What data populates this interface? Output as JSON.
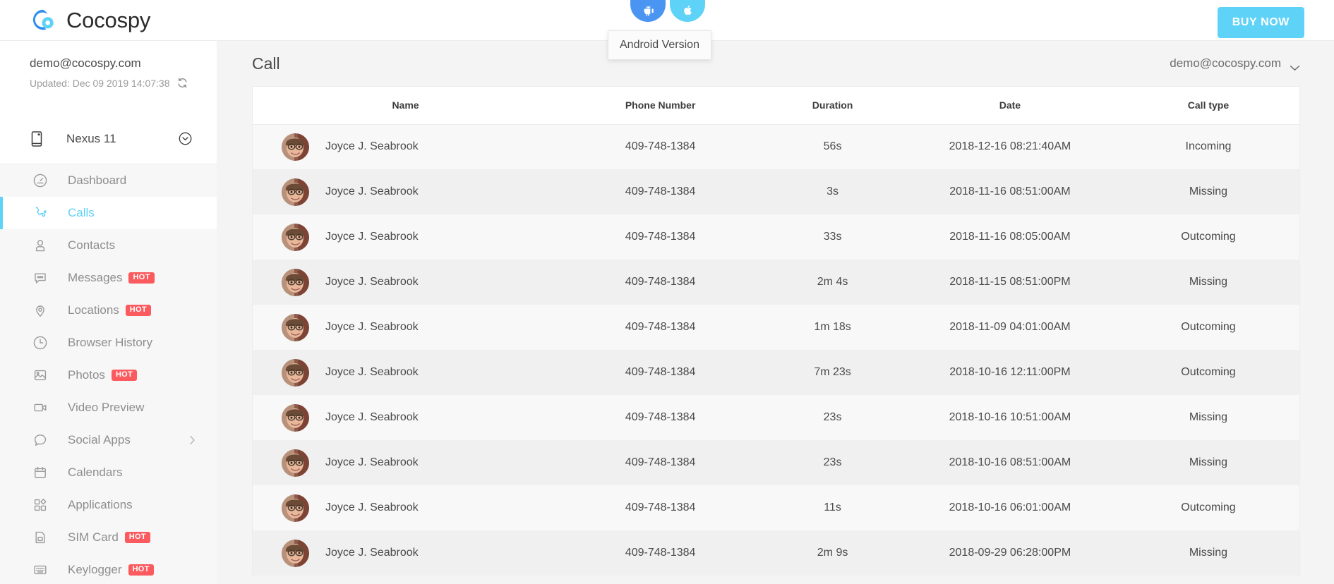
{
  "brand": {
    "name": "Cocospy",
    "logo_icon": "cocospy-logo-icon"
  },
  "topbar": {
    "platform_buttons": [
      {
        "name": "android",
        "icon": "android-icon",
        "color": "#4a95f2"
      },
      {
        "name": "ios",
        "icon": "apple-icon",
        "color": "#5ed2f7"
      }
    ],
    "tooltip": "Android Version",
    "buy_now_label": "BUY NOW",
    "buy_now_color": "#5ed2f7"
  },
  "sidebar": {
    "account_email": "demo@cocospy.com",
    "updated_text": "Updated: Dec 09 2019 14:07:38",
    "refresh_icon": "refresh-icon",
    "device": {
      "name": "Nexus 11",
      "icon": "phone-icon",
      "chevron": "chevron-down-circle-icon"
    },
    "items": [
      {
        "label": "Dashboard",
        "icon": "dashboard-icon",
        "active": false,
        "badge": "",
        "arrow": false
      },
      {
        "label": "Calls",
        "icon": "phone-call-icon",
        "active": true,
        "badge": "",
        "arrow": false
      },
      {
        "label": "Contacts",
        "icon": "contacts-icon",
        "active": false,
        "badge": "",
        "arrow": false
      },
      {
        "label": "Messages",
        "icon": "message-icon",
        "active": false,
        "badge": "HOT",
        "arrow": false
      },
      {
        "label": "Locations",
        "icon": "location-pin-icon",
        "active": false,
        "badge": "HOT",
        "arrow": false
      },
      {
        "label": "Browser History",
        "icon": "clock-icon",
        "active": false,
        "badge": "",
        "arrow": false
      },
      {
        "label": "Photos",
        "icon": "photo-icon",
        "active": false,
        "badge": "HOT",
        "arrow": false
      },
      {
        "label": "Video Preview",
        "icon": "video-camera-icon",
        "active": false,
        "badge": "",
        "arrow": false
      },
      {
        "label": "Social Apps",
        "icon": "chat-bubble-icon",
        "active": false,
        "badge": "",
        "arrow": true
      },
      {
        "label": "Calendars",
        "icon": "calendar-icon",
        "active": false,
        "badge": "",
        "arrow": false
      },
      {
        "label": "Applications",
        "icon": "applications-icon",
        "active": false,
        "badge": "",
        "arrow": false
      },
      {
        "label": "SIM Card",
        "icon": "sim-card-icon",
        "active": false,
        "badge": "HOT",
        "arrow": false
      },
      {
        "label": "Keylogger",
        "icon": "keyboard-icon",
        "active": false,
        "badge": "HOT",
        "arrow": false
      }
    ],
    "accent_color": "#5ed2f7",
    "badge_color": "#fb5a5f"
  },
  "main": {
    "page_title": "Call",
    "account_dropdown": "demo@cocospy.com",
    "table": {
      "columns": [
        "Name",
        "Phone Number",
        "Duration",
        "Date",
        "Call type"
      ],
      "rows": [
        {
          "name": "Joyce J. Seabrook",
          "phone": "409-748-1384",
          "duration": "56s",
          "date": "2018-12-16 08:21:40AM",
          "type": "Incoming"
        },
        {
          "name": "Joyce J. Seabrook",
          "phone": "409-748-1384",
          "duration": "3s",
          "date": "2018-11-16 08:51:00AM",
          "type": "Missing"
        },
        {
          "name": "Joyce J. Seabrook",
          "phone": "409-748-1384",
          "duration": "33s",
          "date": "2018-11-16 08:05:00AM",
          "type": "Outcoming"
        },
        {
          "name": "Joyce J. Seabrook",
          "phone": "409-748-1384",
          "duration": "2m 4s",
          "date": "2018-11-15 08:51:00PM",
          "type": "Missing"
        },
        {
          "name": "Joyce J. Seabrook",
          "phone": "409-748-1384",
          "duration": "1m 18s",
          "date": "2018-11-09 04:01:00AM",
          "type": "Outcoming"
        },
        {
          "name": "Joyce J. Seabrook",
          "phone": "409-748-1384",
          "duration": "7m 23s",
          "date": "2018-10-16 12:11:00PM",
          "type": "Outcoming"
        },
        {
          "name": "Joyce J. Seabrook",
          "phone": "409-748-1384",
          "duration": "23s",
          "date": "2018-10-16 10:51:00AM",
          "type": "Missing"
        },
        {
          "name": "Joyce J. Seabrook",
          "phone": "409-748-1384",
          "duration": "23s",
          "date": "2018-10-16 08:51:00AM",
          "type": "Missing"
        },
        {
          "name": "Joyce J. Seabrook",
          "phone": "409-748-1384",
          "duration": "11s",
          "date": "2018-10-16 06:01:00AM",
          "type": "Outcoming"
        },
        {
          "name": "Joyce J. Seabrook",
          "phone": "409-748-1384",
          "duration": "2m 9s",
          "date": "2018-09-29 06:28:00PM",
          "type": "Missing"
        }
      ]
    }
  }
}
